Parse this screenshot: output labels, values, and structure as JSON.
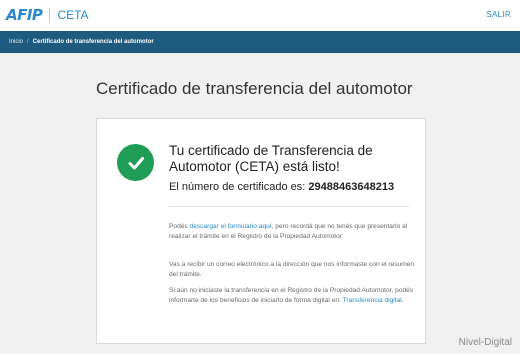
{
  "header": {
    "logo_mark": "AFIP",
    "logo_text": "CETA",
    "logout_label": "SALIR"
  },
  "breadcrumb": {
    "items": [
      "Inicio",
      "Certificado de transferencia del automotor"
    ],
    "separator": "/"
  },
  "page": {
    "title": "Certificado de transferencia del automotor"
  },
  "card": {
    "heading": "Tu certificado de Transferencia de Automotor (CETA) está listo!",
    "cert_label": "El número de certificado es:",
    "cert_number": "29488463648213",
    "p1_before": "Podés ",
    "p1_link": "descargar el formulario aquí",
    "p1_after": ", pero recordá que no tenés que presentarlo al realizar el trámite en el Registro de la Propiedad Automotor",
    "p2": "Vas a recibir un correo electrónico a la dirección que nos informaste con el resumen del trámite.",
    "p3_before": "Si aún no iniciaste la transferencia en el Registro de la Propiedad Automotor, podés informarte de los beneficios de iniciarlo de forma digital en: ",
    "p3_link": "Transferencia digital",
    "p3_after": "."
  },
  "watermark": "Nivel-Digital",
  "colors": {
    "accent": "#2a8ac9",
    "breadcrumb_bg": "#1f5a7f",
    "success": "#1f9d55"
  },
  "icons": {
    "status": "check-circle-icon"
  }
}
